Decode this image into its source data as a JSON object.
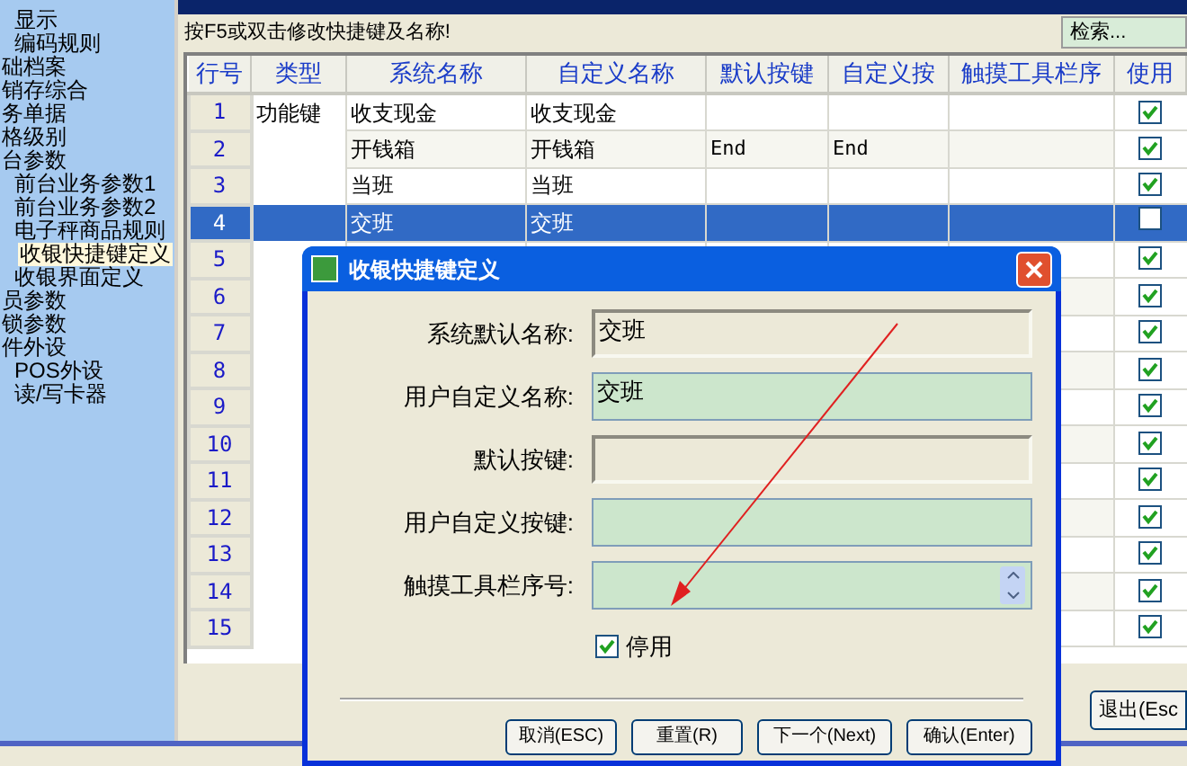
{
  "sidebar": {
    "items": [
      {
        "children": [
          {
            "label": "显示",
            "selected": false
          },
          {
            "label": "编码规则",
            "selected": false
          }
        ]
      },
      {
        "label": "础档案",
        "selected": false
      },
      {
        "label": "销存综合",
        "selected": false
      },
      {
        "label": "务单据",
        "selected": false
      },
      {
        "label": "格级别",
        "selected": false
      },
      {
        "label": "台参数",
        "selected": false,
        "children": [
          {
            "label": "前台业务参数1",
            "selected": false
          },
          {
            "label": "前台业务参数2",
            "selected": false
          },
          {
            "label": "电子秤商品规则",
            "selected": false
          },
          {
            "label": "收银快捷键定义",
            "selected": true
          },
          {
            "label": "收银界面定义",
            "selected": false
          }
        ]
      },
      {
        "label": "员参数",
        "selected": false
      },
      {
        "label": "锁参数",
        "selected": false
      },
      {
        "label": "件外设",
        "selected": false,
        "children": [
          {
            "label": "POS外设",
            "selected": false
          },
          {
            "label": "读/写卡器",
            "selected": false
          }
        ]
      }
    ]
  },
  "hint": "按F5或双击修改快捷键及名称!",
  "search": {
    "placeholder": "检索..."
  },
  "table": {
    "columns": [
      "行号",
      "类型",
      "系统名称",
      "自定义名称",
      "默认按键",
      "自定义按",
      "触摸工具栏序",
      "使用"
    ],
    "rows": [
      {
        "cells": [
          "1",
          "功能键",
          "收支现金",
          "收支现金",
          "",
          "",
          ""
        ],
        "used": true,
        "selected": false
      },
      {
        "cells": [
          "2",
          "",
          "开钱箱",
          "开钱箱",
          "End",
          "End",
          ""
        ],
        "used": true,
        "selected": false
      },
      {
        "cells": [
          "3",
          "",
          "当班",
          "当班",
          "",
          "",
          ""
        ],
        "used": true,
        "selected": false
      },
      {
        "cells": [
          "4",
          "",
          "交班",
          "交班",
          "",
          "",
          ""
        ],
        "used": false,
        "selected": true
      },
      {
        "cells": [
          "5",
          "",
          "",
          "",
          "",
          "",
          ""
        ],
        "used": true,
        "selected": false
      },
      {
        "cells": [
          "6",
          "",
          "",
          "",
          "",
          "",
          ""
        ],
        "used": true,
        "selected": false
      },
      {
        "cells": [
          "7",
          "",
          "",
          "",
          "",
          "",
          ""
        ],
        "used": true,
        "selected": false
      },
      {
        "cells": [
          "8",
          "",
          "",
          "",
          "",
          "",
          ""
        ],
        "used": true,
        "selected": false
      },
      {
        "cells": [
          "9",
          "",
          "",
          "",
          "",
          "",
          ""
        ],
        "used": true,
        "selected": false
      },
      {
        "cells": [
          "10",
          "",
          "",
          "",
          "",
          "",
          ""
        ],
        "used": true,
        "selected": false
      },
      {
        "cells": [
          "11",
          "",
          "",
          "",
          "",
          "",
          ""
        ],
        "used": true,
        "selected": false
      },
      {
        "cells": [
          "12",
          "",
          "",
          "",
          "",
          "",
          ""
        ],
        "used": true,
        "selected": false
      },
      {
        "cells": [
          "13",
          "",
          "",
          "",
          "",
          "",
          ""
        ],
        "used": true,
        "selected": false
      },
      {
        "cells": [
          "14",
          "",
          "",
          "",
          "",
          "",
          ""
        ],
        "used": true,
        "selected": false
      },
      {
        "cells": [
          "15",
          "",
          "",
          "",
          "",
          "",
          ""
        ],
        "used": true,
        "selected": false
      }
    ]
  },
  "exit_button": "退出(Esc",
  "dialog": {
    "title": "收银快捷键定义",
    "fields": [
      {
        "label": "系统默认名称:",
        "kind": "readonly",
        "value": "交班"
      },
      {
        "label": "用户自定义名称:",
        "kind": "editable",
        "value": "交班"
      },
      {
        "label": "默认按键:",
        "kind": "readonly"
      },
      {
        "label": "用户自定义按键:",
        "kind": "editable"
      },
      {
        "label": "触摸工具栏序号:",
        "kind": "spinner"
      }
    ],
    "disable_checkbox": {
      "label": "停用",
      "checked": true
    },
    "buttons": [
      "取消(ESC)",
      "重置(R)",
      "下一个(Next)",
      "确认(Enter)"
    ]
  }
}
